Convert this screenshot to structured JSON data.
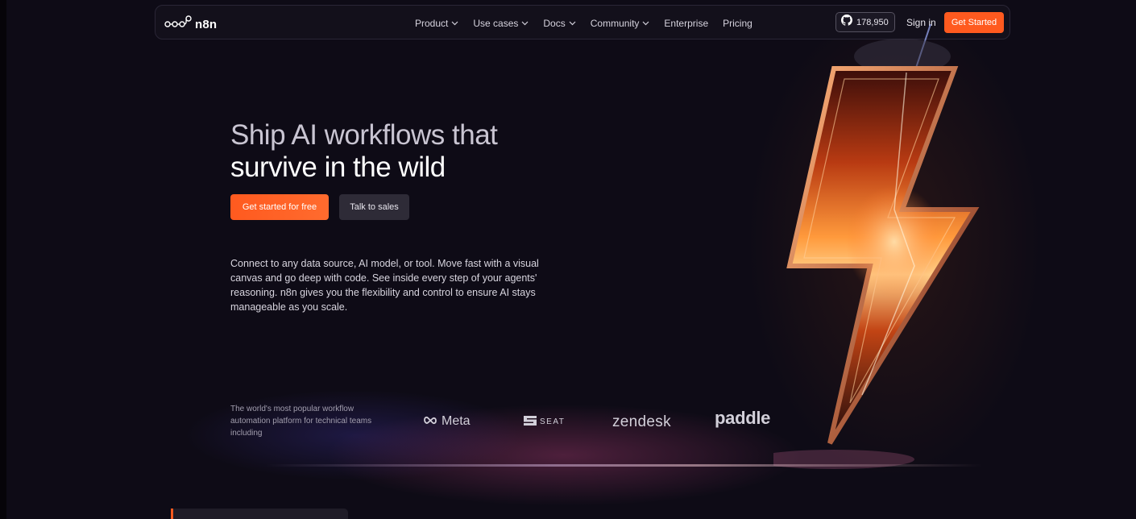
{
  "nav": {
    "logo_text": "n8n",
    "links": [
      {
        "label": "Product",
        "has_menu": true
      },
      {
        "label": "Use cases",
        "has_menu": true
      },
      {
        "label": "Docs",
        "has_menu": true
      },
      {
        "label": "Community",
        "has_menu": true
      },
      {
        "label": "Enterprise",
        "has_menu": false
      },
      {
        "label": "Pricing",
        "has_menu": false
      }
    ],
    "github_stars": "178,950",
    "sign_in": "Sign in",
    "get_started": "Get Started"
  },
  "hero": {
    "title_line1": "Ship AI workflows that",
    "title_line2": "survive in the wild",
    "primary_cta": "Get started for free",
    "secondary_cta": "Talk to sales",
    "description": "Connect to any data source, AI model, or tool. Move fast with a visual canvas and go deep with code. See inside every step of your agents' reasoning. n8n gives you the flexibility and control to ensure AI stays manageable as you scale."
  },
  "logos": {
    "caption": "The world's most popular workflow automation platform for technical teams including",
    "brands": [
      "Meta",
      "SEAT",
      "zendesk",
      "paddle"
    ]
  },
  "colors": {
    "accent": "#ff5a1f",
    "background": "#0e0b16",
    "nav_bg": "#14111c"
  },
  "icons": {
    "logo": "n8n-nodes-icon",
    "github": "github-icon",
    "chevron": "chevron-down-icon",
    "meta": "meta-infinity-icon",
    "seat": "seat-logo-icon"
  }
}
